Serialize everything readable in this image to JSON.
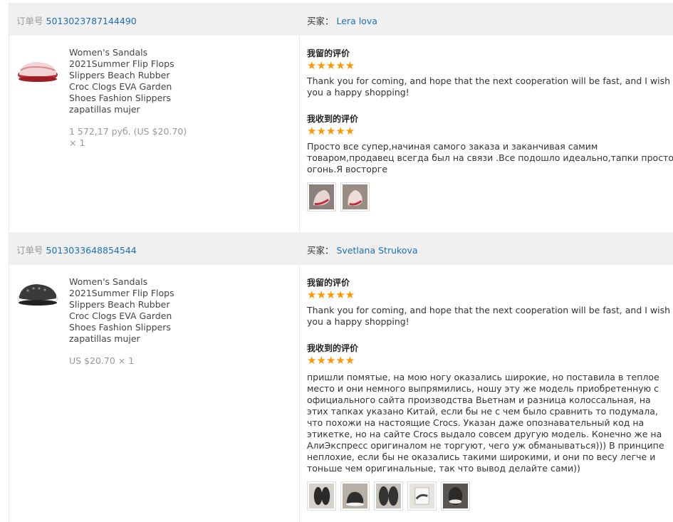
{
  "orders": [
    {
      "order_label": "订单号",
      "order_number": "5013023787144490",
      "buyer_label": "买家：",
      "buyer_name": "Lera lova",
      "product_title": "Women's Sandals 2021Summer Flip Flops Slippers Beach Rubber Croc Clogs EVA Garden Shoes Fashion Slippers zapatillas mujer",
      "price": "1 572,17 руб. (US $20.70)",
      "quantity": "× 1",
      "my_feedback_label": "我留的评价",
      "my_feedback_stars": "★★★★★",
      "my_feedback_text": "Thank you for coming, and hope that the next cooperation will be fast, and I wish you a happy shopping!",
      "received_feedback_label": "我收到的评价",
      "received_feedback_stars": "★★★★★",
      "received_feedback_text": "Просто все супер,начиная самого заказа и заканчивая самим товаром,продавец всегда был на связи .Все подошло идеально,тапки просто огонь.Я восторге",
      "photo_count": 2
    },
    {
      "order_label": "订单号",
      "order_number": "5013033648854544",
      "buyer_label": "买家：",
      "buyer_name": "Svetlana Strukova",
      "product_title": "Women's Sandals 2021Summer Flip Flops Slippers Beach Rubber Croc Clogs EVA Garden Shoes Fashion Slippers zapatillas mujer",
      "price": "US $20.70 × 1",
      "my_feedback_label": "我留的评价",
      "my_feedback_stars": "★★★★★",
      "my_feedback_text": "Thank you for coming, and hope that the next cooperation will be fast, and I wish you a happy shopping!",
      "received_feedback_label": "我收到的评价",
      "received_feedback_stars": "★★★★★",
      "received_feedback_text": "пришли помятые, на мою ногу оказались широкие, но поставила в теплое место и они немного выпрямились, ношу эту же модель приобретенную с официального сайта производства Вьетнам и разница колоссальная, на этих тапках указано Китай, если бы не с чем было сравнить то подумала, что похожи на настоящие Crocs. Указан даже опознавательный код на этикетке, но на сайте Crocs выдало совсем другую модель. Конечно же на АлиЭкспресс оригиналом не торгуют, чего уж обманываться))) В принципе неплохие, если бы не оказались такими широкими, и они по весу легче и тоньше чем оригинальные, так что вывод делайте сами))",
      "photo_count": 5
    }
  ],
  "colors": {
    "link": "#1a6fb5",
    "star": "#ff9800",
    "header_bg": "#f0f0f0"
  }
}
